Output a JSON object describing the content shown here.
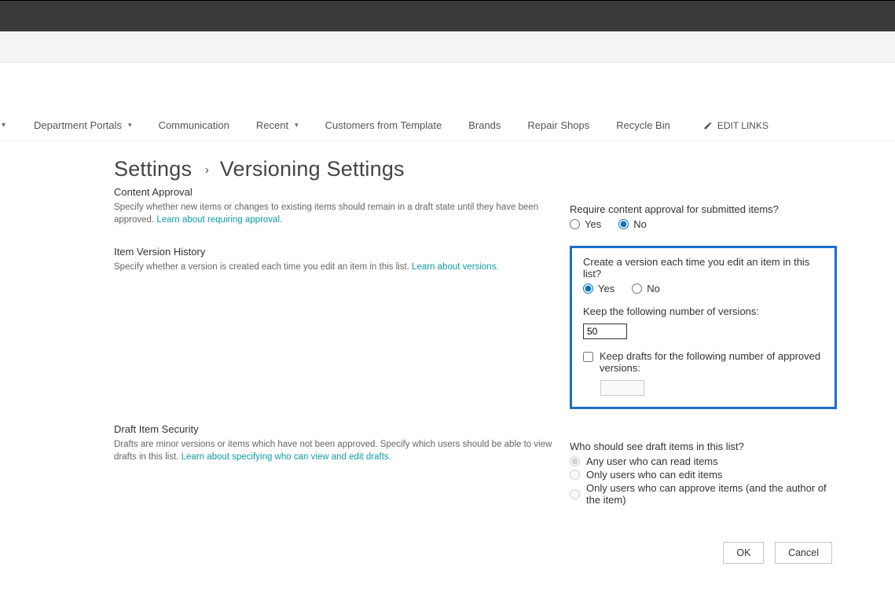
{
  "nav": {
    "items": [
      {
        "label": "Department Portals",
        "caret": true
      },
      {
        "label": "Communication",
        "caret": false
      },
      {
        "label": "Recent",
        "caret": true
      },
      {
        "label": "Customers from Template",
        "caret": false
      },
      {
        "label": "Brands",
        "caret": false
      },
      {
        "label": "Repair Shops",
        "caret": false
      },
      {
        "label": "Recycle Bin",
        "caret": false
      }
    ],
    "edit_links": "EDIT LINKS"
  },
  "breadcrumb": {
    "root": "Settings",
    "page": "Versioning Settings"
  },
  "content_approval": {
    "title": "Content Approval",
    "desc": "Specify whether new items or changes to existing items should remain in a draft state until they have been approved.  ",
    "link": "Learn about requiring approval.",
    "question": "Require content approval for submitted items?",
    "yes": "Yes",
    "no": "No"
  },
  "version_history": {
    "title": "Item Version History",
    "desc": "Specify whether a version is created each time you edit an item in this list.  ",
    "link": "Learn about versions.",
    "question": "Create a version each time you edit an item in this list?",
    "yes": "Yes",
    "no": "No",
    "keep_versions_label": "Keep the following number of versions:",
    "keep_versions_value": "50",
    "keep_drafts_label": "Keep drafts for the following number of approved versions:",
    "keep_drafts_value": ""
  },
  "draft_security": {
    "title": "Draft Item Security",
    "desc": "Drafts are minor versions or items which have not been approved. Specify which users should be able to view drafts in this list.  ",
    "link": "Learn about specifying who can view and edit drafts.",
    "question": "Who should see draft items in this list?",
    "opt1": "Any user who can read items",
    "opt2": "Only users who can edit items",
    "opt3": "Only users who can approve items (and the author of the item)"
  },
  "buttons": {
    "ok": "OK",
    "cancel": "Cancel"
  }
}
